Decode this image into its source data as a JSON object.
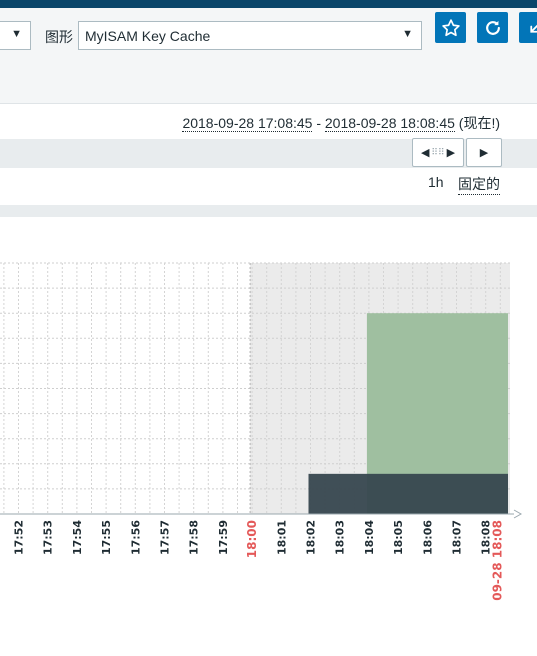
{
  "filter": {
    "graph_label": "图形",
    "graph_selected": "MyISAM Key Cache"
  },
  "icons": [
    "star-icon",
    "refresh-icon",
    "collapse-icon"
  ],
  "time": {
    "from": "2018-09-28 17:08:45",
    "separator": " - ",
    "to": "2018-09-28 18:08:45",
    "now_note": "(现在!)"
  },
  "period": {
    "value": "1h",
    "fixed_label": "固定的"
  },
  "colors": {
    "series_1": "#9fbfa0",
    "series_2": "#37474f",
    "highlight_label": "#e45959",
    "topbar": "#0a466a",
    "button": "#0275b8"
  },
  "chart_data": {
    "type": "area",
    "x": [
      "17:52",
      "17:53",
      "17:54",
      "17:55",
      "17:56",
      "17:57",
      "17:58",
      "17:59",
      "18:00",
      "18:01",
      "18:02",
      "18:03",
      "18:04",
      "18:05",
      "18:06",
      "18:07",
      "18:08"
    ],
    "highlight_ticks": [
      "18:00"
    ],
    "end_label": "09-28 18:08",
    "grid": true,
    "shaded_from": "18:00",
    "series": [
      {
        "color": "#9fbfa0",
        "values": [
          0,
          0,
          0,
          0,
          0,
          0,
          0,
          0,
          0,
          0,
          0,
          0,
          8,
          8,
          8,
          8,
          8
        ]
      },
      {
        "color": "#37474f",
        "values": [
          0,
          0,
          0,
          0,
          0,
          0,
          0,
          0,
          0,
          0,
          1.6,
          1.6,
          1.6,
          1.6,
          1.6,
          1.6,
          1.6
        ]
      }
    ],
    "ylim": [
      0,
      10
    ]
  }
}
